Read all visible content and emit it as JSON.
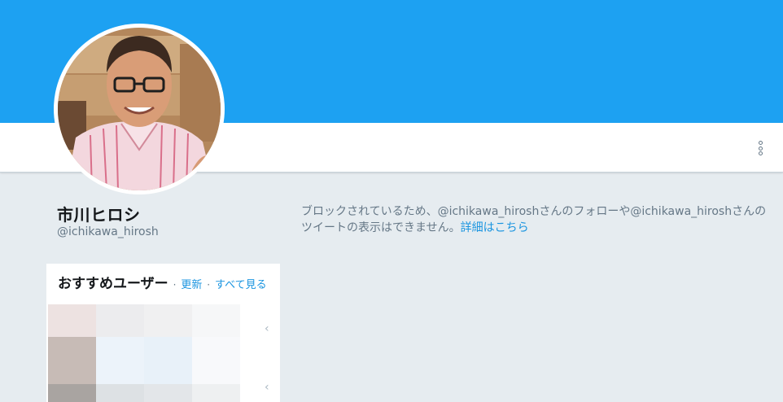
{
  "profile": {
    "name": "市川ヒロシ",
    "handle": "@ichikawa_hirosh"
  },
  "blocked": {
    "message": "ブロックされているため、@ichikawa_hiroshさんのフォローや@ichikawa_hiroshさんのツイートの表示はできません。",
    "link": "詳細はこちら"
  },
  "suggestions": {
    "title": "おすすめユーザー",
    "refresh": "更新",
    "view_all": "すべて見る",
    "separator": "·",
    "chevron": "‹"
  },
  "icons": {
    "more": "more-vertical-icon",
    "chevron": "chevron-left-icon"
  },
  "colors": {
    "banner": "#1da1f2",
    "page_background": "#e6ecf0",
    "link": "#1b95e0",
    "muted_text": "#657786"
  }
}
